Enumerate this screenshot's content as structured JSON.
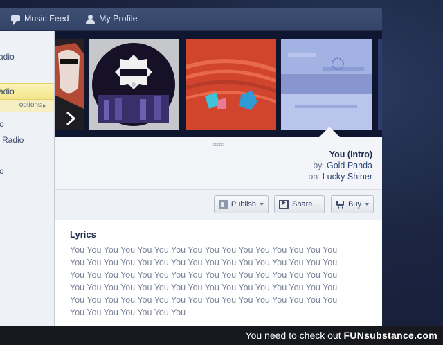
{
  "nav": {
    "music_feed": "Music Feed",
    "my_profile": "My Profile"
  },
  "sidebar": {
    "items": [
      "adio",
      "adio",
      "o",
      "Radio",
      "o"
    ],
    "options": "options"
  },
  "albums": [
    "album-cover-1",
    "album-cover-kuedo",
    "album-cover-galactic",
    "album-cover-you-intro",
    "album-cover-5"
  ],
  "track": {
    "title": "You (Intro)",
    "by_prefix": "by",
    "artist": "Gold Panda",
    "on_prefix": "on",
    "album": "Lucky Shiner"
  },
  "actions": {
    "publish": "Publish",
    "share": "Share...",
    "buy": "Buy"
  },
  "lyrics": {
    "heading": "Lyrics",
    "lines": [
      "You You You You You You You You You You You You You You You You",
      "You You You You You You You You You You You You You You You You",
      "You You You You You You You You You You You You You You You You",
      "You You You You You You You You You You You You You You You You",
      "You You You You You You You You You You You You You You You You",
      "You You You You You You You"
    ]
  },
  "watermark": {
    "text": "You need to check out ",
    "brand": "FUNsubstance.com"
  },
  "colors": {
    "accent_yellow": "#f3e58a",
    "nav_blue": "#3d4f73",
    "link_blue": "#2d4575"
  }
}
